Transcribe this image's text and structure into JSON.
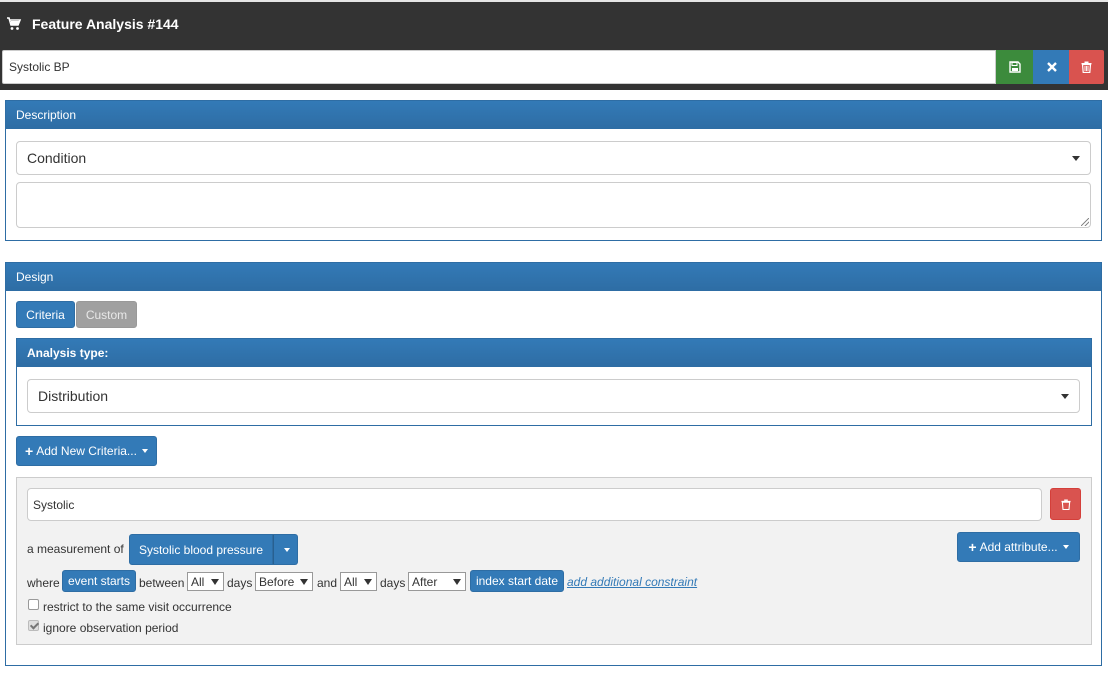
{
  "header": {
    "title": "Feature Analysis #144",
    "name_value": "Systolic BP",
    "icons": {
      "cart": "cart-icon",
      "save": "save-icon",
      "close": "close-icon",
      "delete": "trash-icon"
    }
  },
  "description": {
    "heading": "Description",
    "domain_select": "Condition",
    "textarea_value": ""
  },
  "design": {
    "heading": "Design",
    "tabs": [
      {
        "label": "Criteria"
      },
      {
        "label": "Custom"
      }
    ],
    "analysis_type": {
      "heading": "Analysis type:",
      "selected": "Distribution"
    },
    "add_criteria_label": "Add New Criteria...",
    "criteria": {
      "name": "Systolic",
      "measurement_prefix": "a measurement of",
      "concept": "Systolic blood pressure",
      "add_attribute_label": "Add attribute...",
      "where_label": "where",
      "event_starts_label": "event starts",
      "between_label": "between",
      "start_days": "All",
      "days_label_1": "days",
      "start_relation": "Before",
      "and_label": "and",
      "end_days": "All",
      "days_label_2": "days",
      "end_relation": "After",
      "index_label": "index start date",
      "add_constraint_label": "add additional constraint",
      "restrict_visit_label": "restrict to the same visit occurrence",
      "restrict_visit_checked": false,
      "ignore_obs_label": "ignore observation period",
      "ignore_obs_checked": true
    }
  },
  "colors": {
    "primary": "#337ab7",
    "success": "#3c8b3c",
    "danger": "#d9534f",
    "header_bg": "#333333",
    "secondary": "#a0a0a0"
  }
}
